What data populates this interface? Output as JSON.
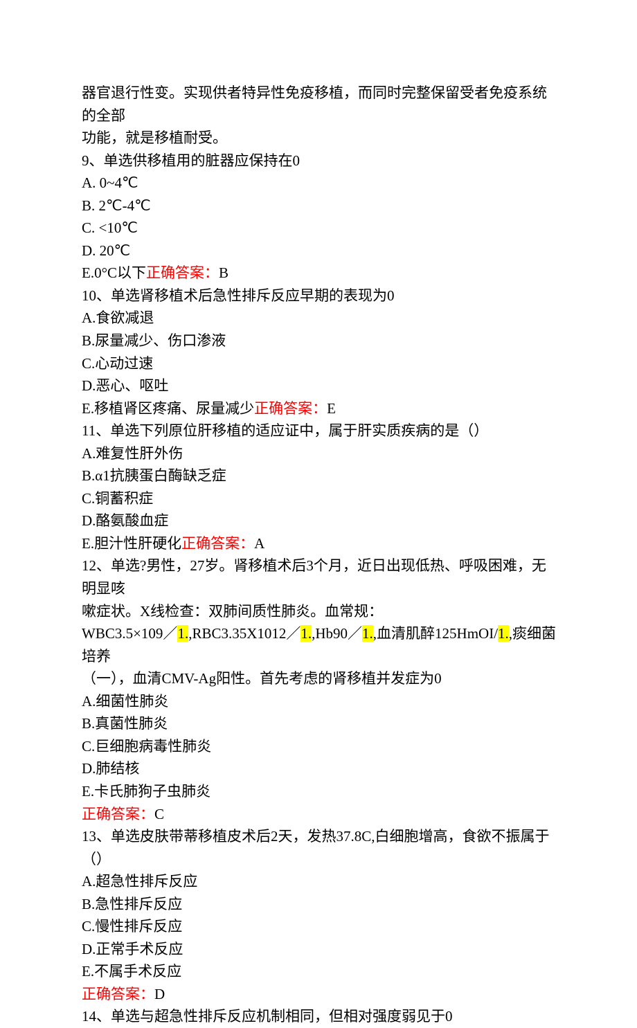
{
  "intro": {
    "l1": "器官退行性变。实现供者特异性免疫移植，而同时完整保留受者免疫系统的全部",
    "l2": "功能，就是移植耐受。"
  },
  "q9": {
    "stem": "9、单选供移植用的脏器应保持在0",
    "a": "A. 0~4℃",
    "b": "B. 2℃-4℃",
    "c": "C. <10℃",
    "d": "D. 20℃",
    "e_pre": "E.0°C以下",
    "ans_label": "正确答案：",
    "ans_val": "B"
  },
  "q10": {
    "stem": "10、单选肾移植术后急性排斥反应早期的表现为0",
    "a": "A.食欲减退",
    "b": "B.尿量减少、伤口渗液",
    "c": "C.心动过速",
    "d": "D.恶心、呕吐",
    "e_pre": "E.移植肾区疼痛、尿量减少",
    "ans_label": "正确答案：",
    "ans_val": "E"
  },
  "q11": {
    "stem": "11、单选下列原位肝移植的适应证中，属于肝实质疾病的是（）",
    "a": "A.难复性肝外伤",
    "b": "B.α1抗胰蛋白酶缺乏症",
    "c": "C.铜蓄积症",
    "d": "D.酪氨酸血症",
    "e_pre": "E.胆汁性肝硬化",
    "ans_label": "正确答案：",
    "ans_val": "A"
  },
  "q12": {
    "stem_l1": "12、单选?男性，27岁。肾移植术后3个月，近日出现低热、呼吸困难，无明显咳",
    "stem_l2": "嗽症状。X线检查：双肺间质性肺炎。血常规：",
    "lab": {
      "p1": "WBC3.5×109／",
      "h1": "1.",
      "p2": ",RBC3.35X1012／",
      "h2": "1.",
      "p3": ",Hb90／",
      "h3": "1.",
      "p4": ",血清肌醉125HmOI/",
      "h4": "1.",
      "p5": ",痰细菌培养"
    },
    "stem_l4": "（一），血清CMV-Ag阳性。首先考虑的肾移植并发症为0",
    "a": "A.细菌性肺炎",
    "b": "B.真菌性肺炎",
    "c": "C.巨细胞病毒性肺炎",
    "d": "D.肺结核",
    "e": "E.卡氏肺狗子虫肺炎",
    "ans_label": "正确答案：",
    "ans_val": "C"
  },
  "q13": {
    "stem": "13、单选皮肤带蒂移植皮术后2天，发热37.8C,白细胞增高，食欲不振属于（）",
    "a": "A.超急性排斥反应",
    "b": "B.急性排斥反应",
    "c": "C.慢性排斥反应",
    "d": "D.正常手术反应",
    "e": "E.不属手术反应",
    "ans_label": "正确答案：",
    "ans_val": "D"
  },
  "q14": {
    "stem": "14、单选与超急性排斥反应机制相同，但相对强度弱见于0"
  }
}
